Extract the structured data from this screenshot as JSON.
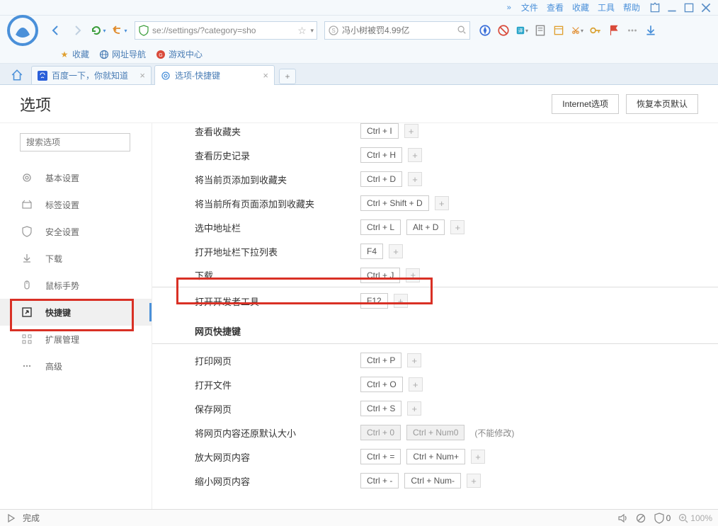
{
  "menubar": {
    "items": [
      "文件",
      "查看",
      "收藏",
      "工具",
      "帮助"
    ]
  },
  "toolbar": {
    "url": "se://settings/?category=sho",
    "search_placeholder": "冯小树被罚4.99亿"
  },
  "bookmarks": {
    "fav": "收藏",
    "nav": "网址导航",
    "game": "游戏中心"
  },
  "tabs": {
    "tab1": "百度一下，你就知道",
    "tab2": "选项-快捷键"
  },
  "header": {
    "title": "选项",
    "btn_internet": "Internet选项",
    "btn_restore": "恢复本页默认"
  },
  "sidebar": {
    "search_placeholder": "搜索选项",
    "items": [
      "基本设置",
      "标签设置",
      "安全设置",
      "下载",
      "鼠标手势",
      "快捷键",
      "扩展管理",
      "高级"
    ]
  },
  "rows": {
    "r0": {
      "label": "查看收藏夹",
      "keys": [
        "Ctrl + I"
      ]
    },
    "r1": {
      "label": "查看历史记录",
      "keys": [
        "Ctrl + H"
      ]
    },
    "r2": {
      "label": "将当前页添加到收藏夹",
      "keys": [
        "Ctrl + D"
      ]
    },
    "r3": {
      "label": "将当前所有页面添加到收藏夹",
      "keys": [
        "Ctrl + Shift + D"
      ]
    },
    "r4": {
      "label": "选中地址栏",
      "keys": [
        "Ctrl + L",
        "Alt + D"
      ]
    },
    "r5": {
      "label": "打开地址栏下拉列表",
      "keys": [
        "F4"
      ]
    },
    "r6": {
      "label": "下载",
      "keys": [
        "Ctrl + J"
      ]
    },
    "r7": {
      "label": "打开开发者工具",
      "keys": [
        "F12"
      ]
    }
  },
  "section2": "网页快捷键",
  "rows2": {
    "p1": {
      "label": "打印网页",
      "keys": [
        "Ctrl + P"
      ]
    },
    "p2": {
      "label": "打开文件",
      "keys": [
        "Ctrl + O"
      ]
    },
    "p3": {
      "label": "保存网页",
      "keys": [
        "Ctrl + S"
      ]
    },
    "p4": {
      "label": "将网页内容还原默认大小",
      "keys": [
        "Ctrl + 0",
        "Ctrl + Num0"
      ],
      "note": "(不能修改)"
    },
    "p5": {
      "label": "放大网页内容",
      "keys": [
        "Ctrl + =",
        "Ctrl + Num+"
      ]
    },
    "p6": {
      "label": "缩小网页内容",
      "keys": [
        "Ctrl + -",
        "Ctrl + Num-"
      ]
    }
  },
  "status": {
    "done": "完成",
    "zoom": "100%",
    "secure": "0"
  }
}
